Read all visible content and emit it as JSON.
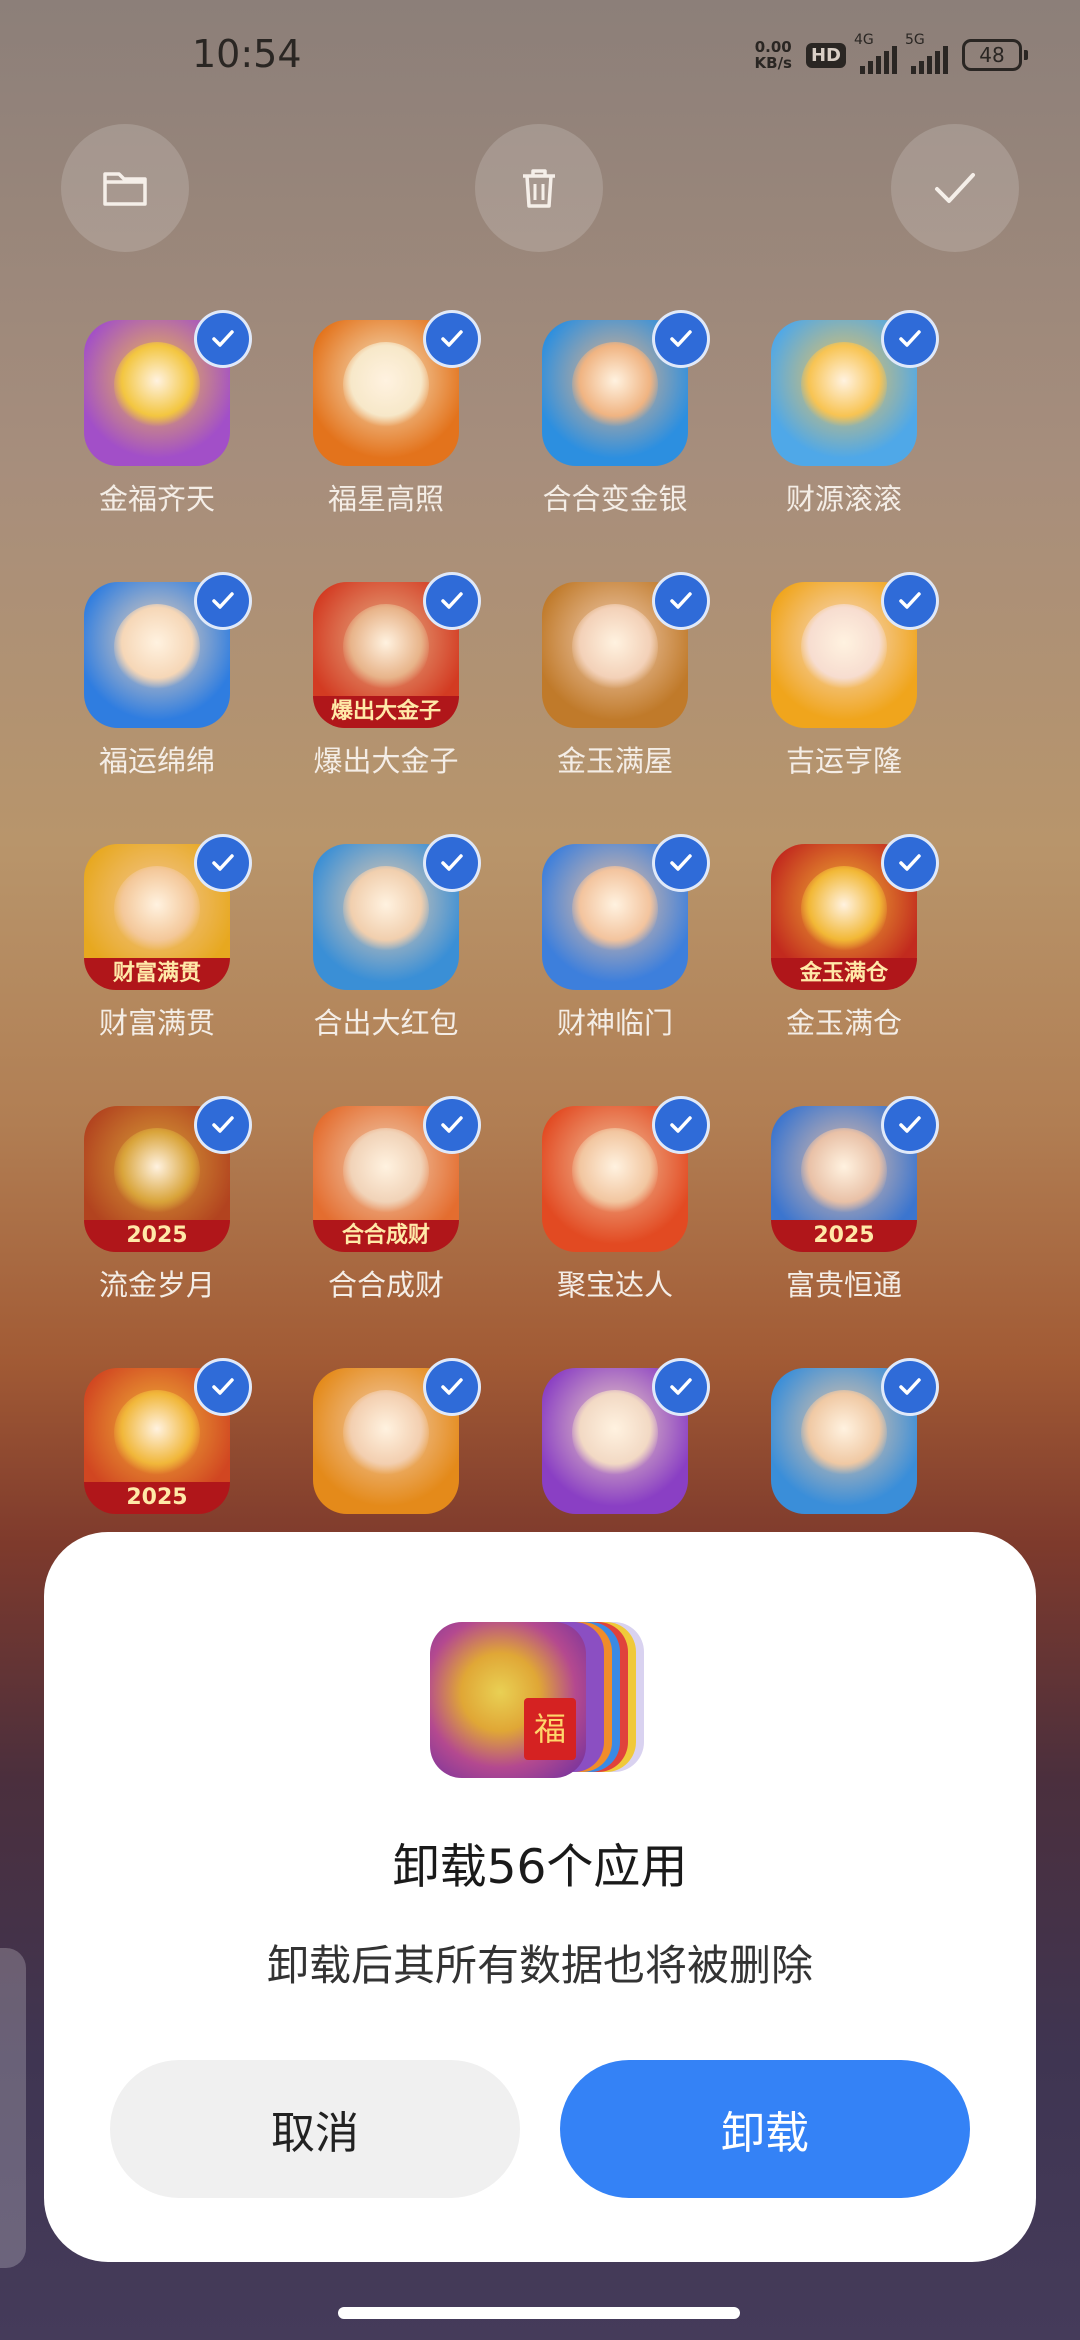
{
  "status_bar": {
    "time": "10:54",
    "net_speed_value": "0.00",
    "net_speed_unit": "KB/s",
    "hd_badge": "HD",
    "sim1_type": "4G",
    "sim2_type": "5G",
    "battery": "48"
  },
  "top_actions": {
    "folder_icon": "folder-icon",
    "delete_icon": "trash-icon",
    "confirm_icon": "check-icon"
  },
  "apps": [
    {
      "label": "金福齐天",
      "banner": "",
      "bg": "#a24fc8",
      "accent": "#f3c640"
    },
    {
      "label": "福星高照",
      "banner": "",
      "bg": "#e3731c",
      "accent": "#f7e8c9"
    },
    {
      "label": "合合变金银",
      "banner": "",
      "bg": "#2c8fe0",
      "accent": "#f0b482"
    },
    {
      "label": "财源滚滚",
      "banner": "",
      "bg": "#4fa8e8",
      "accent": "#f8c453"
    },
    {
      "label": "福运绵绵",
      "banner": "",
      "bg": "#2f7de0",
      "accent": "#f6d7b7"
    },
    {
      "label": "爆出大金子",
      "banner": "爆出大金子",
      "bg": "#d33b22",
      "accent": "#e8b48a"
    },
    {
      "label": "金玉满屋",
      "banner": "",
      "bg": "#c07a2a",
      "accent": "#f3d1b8"
    },
    {
      "label": "吉运亨隆",
      "banner": "",
      "bg": "#f0a51c",
      "accent": "#f7ddd0"
    },
    {
      "label": "财富满贯",
      "banner": "财富满贯",
      "bg": "#e7a81f",
      "accent": "#f4c89a"
    },
    {
      "label": "合出大红包",
      "banner": "",
      "bg": "#3a8fd6",
      "accent": "#f1cfae"
    },
    {
      "label": "财神临门",
      "banner": "",
      "bg": "#3d7fdc",
      "accent": "#f3c49e"
    },
    {
      "label": "金玉满仓",
      "banner": "金玉满仓",
      "bg": "#c22a1e",
      "accent": "#f2b836"
    },
    {
      "label": "流金岁月",
      "banner": "2025",
      "bg": "#b2431f",
      "accent": "#d9a43a"
    },
    {
      "label": "合合成财",
      "banner": "合合成财",
      "bg": "#e46d2f",
      "accent": "#f1d3b8"
    },
    {
      "label": "聚宝达人",
      "banner": "",
      "bg": "#e24a22",
      "accent": "#f2c6a0"
    },
    {
      "label": "富贵恒通",
      "banner": "2025",
      "bg": "#3b75cf",
      "accent": "#e9c1a7"
    },
    {
      "label": "",
      "banner": "2025",
      "bg": "#d14621",
      "accent": "#f1b73a"
    },
    {
      "label": "",
      "banner": "",
      "bg": "#e48a1a",
      "accent": "#f3cfb0"
    },
    {
      "label": "",
      "banner": "",
      "bg": "#8a3fc4",
      "accent": "#f2d9c4"
    },
    {
      "label": "",
      "banner": "",
      "bg": "#3a8ed9",
      "accent": "#f0c9a4"
    }
  ],
  "dialog": {
    "stack_badge": "福",
    "title": "卸载56个应用",
    "description": "卸载后其所有数据也将被删除",
    "cancel_label": "取消",
    "confirm_label": "卸载",
    "confirm_color": "#3482f6"
  }
}
